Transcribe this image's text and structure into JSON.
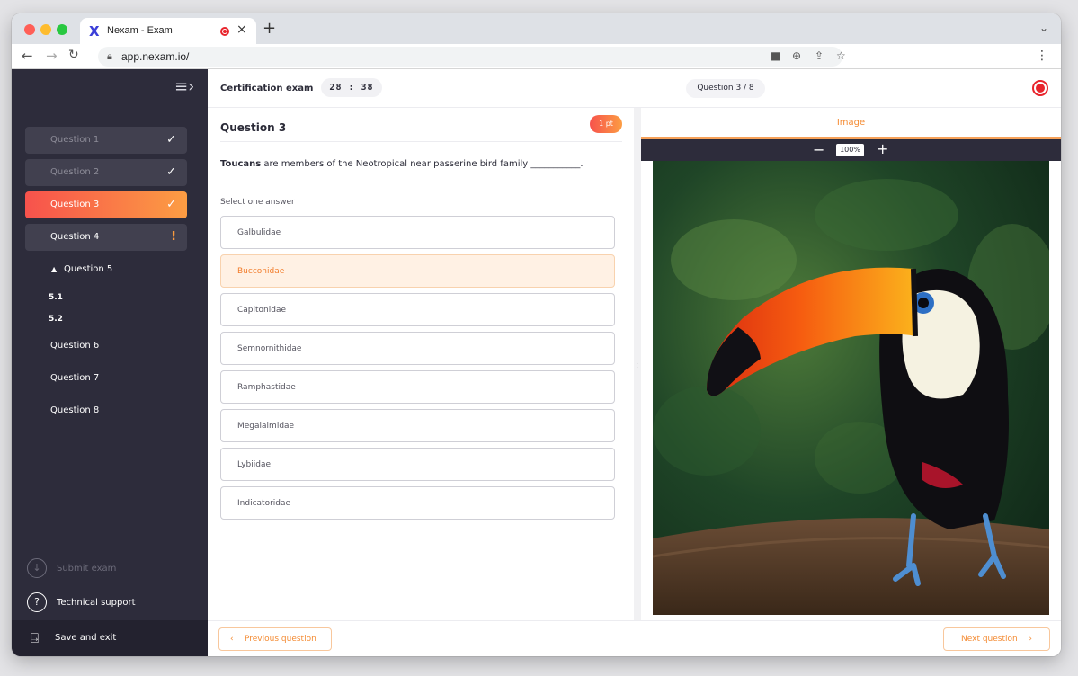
{
  "browser": {
    "tab_title": "Nexam - Exam",
    "tab_logo": "X",
    "close_glyph": "×",
    "new_tab_glyph": "+",
    "url": "app.nexam.io/"
  },
  "sidebar": {
    "items": [
      {
        "label": "Question 1",
        "state": "answered",
        "mark": "✓"
      },
      {
        "label": "Question 2",
        "state": "answered",
        "mark": "✓"
      },
      {
        "label": "Question 3",
        "state": "active",
        "mark": "✓"
      },
      {
        "label": "Question 4",
        "state": "flagged",
        "mark": "!"
      },
      {
        "label": "Question 5",
        "state": "expanded",
        "subitems": [
          "5.1",
          "5.2"
        ]
      },
      {
        "label": "Question 6",
        "state": "unanswered"
      },
      {
        "label": "Question 7",
        "state": "unanswered"
      },
      {
        "label": "Question 8",
        "state": "unanswered"
      }
    ],
    "submit_label": "Submit exam",
    "support_label": "Technical support",
    "save_exit_label": "Save and exit"
  },
  "header": {
    "exam_title": "Certification exam",
    "timer": "28 : 38",
    "question_counter": "Question 3 / 8"
  },
  "question": {
    "heading": "Question 3",
    "points": "1 pt",
    "text_bold": "Toucans",
    "text_rest": " are members of the Neotropical near passerine bird family ___________.",
    "instruction": "Select one answer",
    "answers": [
      {
        "label": "Galbulidae"
      },
      {
        "label": "Bucconidae",
        "selected": true
      },
      {
        "label": "Capitonidae"
      },
      {
        "label": "Semnornithidae"
      },
      {
        "label": "Ramphastidae"
      },
      {
        "label": "Megalaimidae"
      },
      {
        "label": "Lybiidae"
      },
      {
        "label": "Indicatoridae"
      }
    ]
  },
  "image_panel": {
    "tab_label": "Image",
    "zoom": "100%"
  },
  "footer": {
    "prev_label": "Previous question",
    "next_label": "Next question"
  },
  "colors": {
    "accent_start": "#f7524c",
    "accent_end": "#fc9d43",
    "sidebar_bg": "#2d2c3b",
    "accent_text": "#f48b33"
  },
  "icons": {
    "answered": "check-icon",
    "flagged": "exclamation-icon",
    "recording": "record-icon",
    "support": "question-circle-icon",
    "submit": "download-circle-icon",
    "exit": "exit-door-icon"
  }
}
